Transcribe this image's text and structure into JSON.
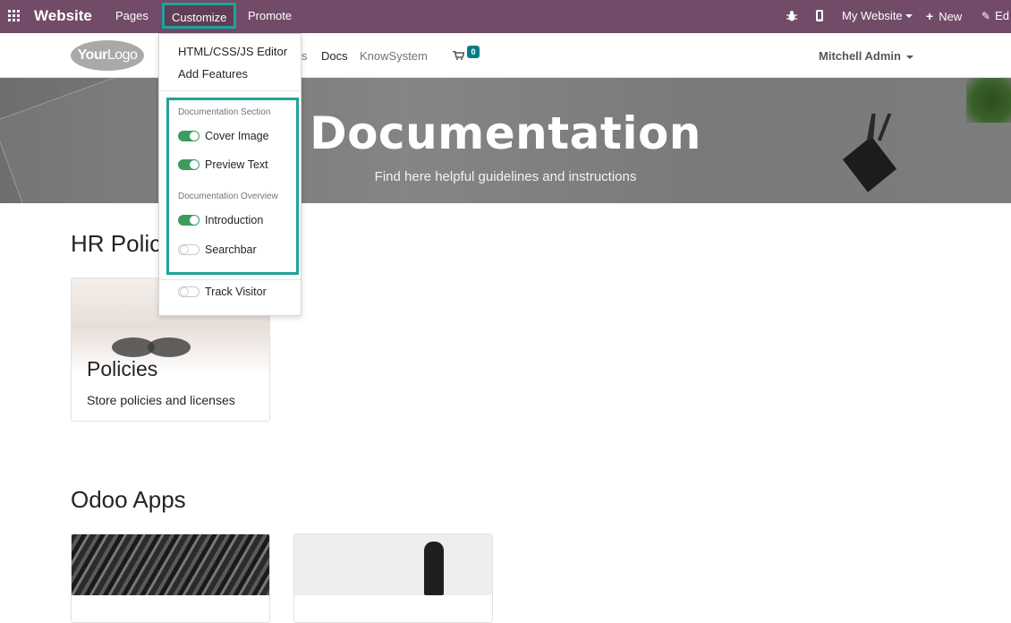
{
  "topbar": {
    "brand": "Website",
    "menus": {
      "pages": "Pages",
      "customize": "Customize",
      "promote": "Promote"
    },
    "my_website": "My Website",
    "new": "New",
    "edit": "Ed"
  },
  "header": {
    "logo_text_bold": "Your",
    "logo_text": "Logo",
    "nav_partial": "s",
    "nav_docs": "Docs",
    "nav_knowsystem": "KnowSystem",
    "cart_count": "0",
    "user": "Mitchell Admin"
  },
  "hero": {
    "title": "Documentation",
    "subtitle": "Find here helpful guidelines and instructions"
  },
  "customize_menu": {
    "editor": "HTML/CSS/JS Editor",
    "add_features": "Add Features",
    "section_header": "Documentation Section",
    "cover_image": {
      "label": "Cover Image",
      "on": true
    },
    "preview_text": {
      "label": "Preview Text",
      "on": true
    },
    "overview_header": "Documentation Overview",
    "introduction": {
      "label": "Introduction",
      "on": true
    },
    "searchbar": {
      "label": "Searchbar",
      "on": false
    },
    "track_visitor": {
      "label": "Track Visitor",
      "on": false
    }
  },
  "sections": {
    "hr_title": "HR Polic",
    "policies_card": {
      "title": "Policies",
      "description": "Store policies and licenses"
    },
    "apps_title": "Odoo Apps"
  },
  "colors": {
    "topbar": "#714b67",
    "highlight": "#1fa39b",
    "toggle_on": "#3c9b5d",
    "cart_badge": "#017e84"
  }
}
